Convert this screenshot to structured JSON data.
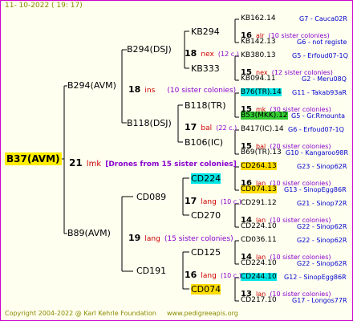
{
  "header": {
    "date": "11-  10-2022  ( 19:  17)"
  },
  "footer": {
    "copyright": "Copyright 2004-2022 @ Karl Kehrle Foundation",
    "url": "www.pedigreeapis.org"
  },
  "root": {
    "name": "B37(AVM)",
    "num": "21",
    "label": "lmk",
    "drones": "[Drones from 15 sister colonies]"
  },
  "gen1": [
    {
      "name": "B294(AVM)",
      "num": "18",
      "label": "ins",
      "sis": "(10 sister colonies)"
    },
    {
      "name": "B89(AVM)",
      "num": "19",
      "label": "lang",
      "sis": "(15 sister colonies)"
    }
  ],
  "gen2": [
    {
      "name": "B294(DSJ)",
      "num": "18",
      "label": "nex",
      "sis": "(12 c.)"
    },
    {
      "name": "B118(DSJ)",
      "num": "17",
      "label": "bal",
      "sis": "(22 c.)"
    },
    {
      "name": "CD089",
      "num": "17",
      "label": "lang",
      "sis": "(10 c.)"
    },
    {
      "name": "CD191",
      "num": "16",
      "label": "lang",
      "sis": "(10 c.)"
    }
  ],
  "gen3": [
    {
      "name": "KB294"
    },
    {
      "name": "KB333"
    },
    {
      "name": "B118(TR)",
      "num": "15",
      "label": "mk",
      "sis": "(30 sister colonies)"
    },
    {
      "name": "B106(IC)"
    },
    {
      "name": "CD224",
      "num": "16",
      "label": "lan",
      "sis": "(10 sister colonies)"
    },
    {
      "name": "CD270",
      "num": "14",
      "label": "lan",
      "sis": "(10 sister colonies)"
    },
    {
      "name": "CD125",
      "num": "14",
      "label": "lan",
      "sis": "(10 sister colonies)"
    },
    {
      "name": "CD074",
      "num": "13",
      "label": "lan",
      "sis": "(10 sister colonies)"
    }
  ],
  "leaves": [
    {
      "name": "KB162.14",
      "info": "G7 - Cauca02R"
    },
    {
      "num": "16",
      "label": "alr",
      "sis": "(10 sister colonies)"
    },
    {
      "name": "KB142.13",
      "info": "G6 - not registe"
    },
    {
      "name": "KB380.13",
      "info": "G5 - Erfoud07-1Q"
    },
    {
      "num": "15",
      "label": "nex",
      "sis": "(12 sister colonies)"
    },
    {
      "name": "KB094.11",
      "info": "G2 - Meru08Q"
    },
    {
      "name": "B76(TR).14",
      "info": "G11 - Takab93aR"
    },
    {
      "name": "B53(MKK).12",
      "info": "G5 - Gr.Rmounta"
    },
    {
      "name": "B417(IC).14",
      "info": "G6 - Erfoud07-1Q"
    },
    {
      "num": "15",
      "label": "bal",
      "sis": "(20 sister colonies)"
    },
    {
      "name": "B69(TR).13",
      "info": "G10 - Kangaroo98R"
    },
    {
      "name": "CD264.13",
      "info": "G23 - Sinop62R"
    },
    {
      "name": "CD074.13",
      "info": "G13 - SinopEgg86R"
    },
    {
      "name": "CD291.12",
      "info": "G21 - Sinop72R"
    },
    {
      "name": "CD224.10",
      "info": "G22 - Sinop62R"
    },
    {
      "name": "CD036.11",
      "info": "G22 - Sinop62R"
    },
    {
      "name": "CD224.10",
      "info": "G22 - Sinop62R"
    },
    {
      "name": "CD244.10",
      "info": "G12 - SinopEgg86R"
    },
    {
      "name": "CD217.10",
      "info": "G17 - Longos77R"
    }
  ]
}
